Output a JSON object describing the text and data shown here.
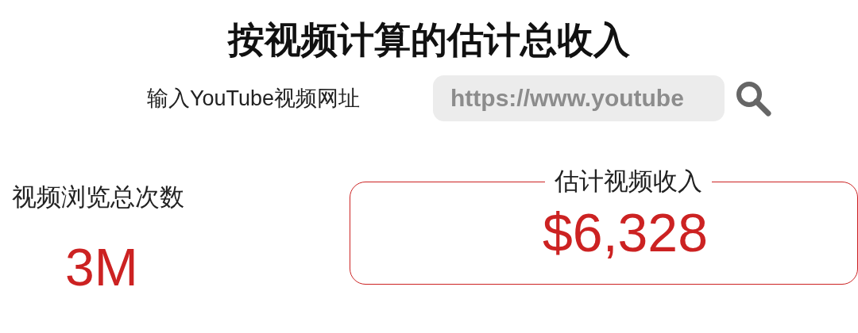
{
  "title": "按视频计算的估计总收入",
  "url_input": {
    "label": "输入YouTube视频网址",
    "placeholder": "https://www.youtube"
  },
  "views": {
    "label": "视频浏览总次数",
    "value": "3M"
  },
  "revenue": {
    "label": "估计视频收入",
    "value": "$6,328"
  }
}
